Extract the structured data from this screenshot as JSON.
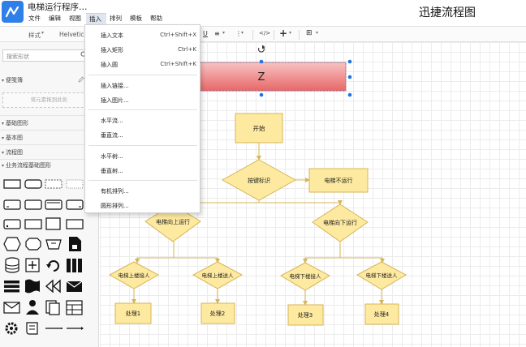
{
  "app": {
    "title": "电梯运行程序…",
    "brand": "迅捷流程图"
  },
  "menubar": [
    {
      "label": "文件"
    },
    {
      "label": "编辑"
    },
    {
      "label": "视图"
    },
    {
      "label": "插入",
      "active": true
    },
    {
      "label": "排列"
    },
    {
      "label": "模板"
    },
    {
      "label": "帮助"
    }
  ],
  "toolbar": {
    "style_label": "样式",
    "font_label": "Helvetic",
    "underline": "U",
    "align": "≡",
    "more": "⋮",
    "code": "</>",
    "insert": "+",
    "table": "⊞",
    "caret": "▾"
  },
  "sidebar": {
    "search_placeholder": "搜索形状",
    "sections": {
      "scratchpad": "便笺簿",
      "basic_shapes": "基础图形",
      "basic_diagram": "基本图",
      "flowchart": "流程图",
      "business_flow": "业务流程基础图形"
    },
    "dropzone": "将元素拖到此处",
    "collapse_icon": "▾"
  },
  "insert_menu": {
    "items": [
      {
        "label": "插入文本",
        "shortcut": "Ctrl+Shift+X"
      },
      {
        "label": "插入矩形",
        "shortcut": "Ctrl+K"
      },
      {
        "label": "插入圆",
        "shortcut": "Ctrl+Shift+K"
      },
      {
        "label": "插入链接...",
        "shortcut": ""
      },
      {
        "label": "插入图片...",
        "shortcut": ""
      },
      {
        "label": "水平流...",
        "shortcut": ""
      },
      {
        "label": "垂直流...",
        "shortcut": ""
      },
      {
        "label": "水平树...",
        "shortcut": ""
      },
      {
        "label": "垂直树...",
        "shortcut": ""
      },
      {
        "label": "有机排列...",
        "shortcut": ""
      },
      {
        "label": "圆形排列...",
        "shortcut": ""
      }
    ]
  },
  "diagram": {
    "selected_box": "Z",
    "start": "开始",
    "decision_main": "按键标识",
    "elevator_stop": "电梯不运行",
    "go_up": "电梯向上运行",
    "go_down": "电梯向下运行",
    "up_pick": "电梯上楼接人",
    "up_send": "电梯上楼送人",
    "down_pick": "电梯下楼接人",
    "down_send": "电梯下楼送人",
    "p1": "处理1",
    "p2": "处理2",
    "p3": "处理3",
    "p4": "处理4"
  },
  "colors": {
    "accent": "#2f7fe8",
    "node_fill": "#fde9a0",
    "node_stroke": "#d6b656",
    "selected_fill": "#ea6b6b",
    "handle": "#1e73e8"
  }
}
